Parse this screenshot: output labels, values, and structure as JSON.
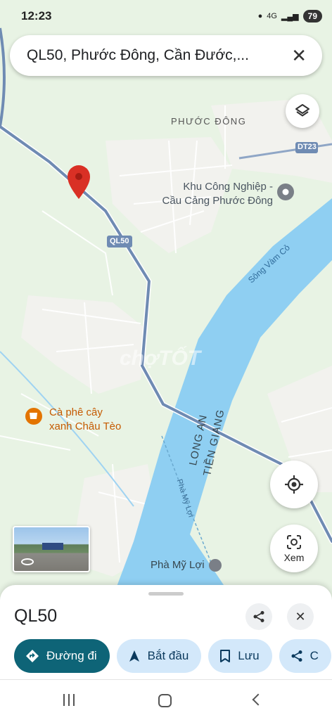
{
  "status": {
    "time": "12:23",
    "battery": "79",
    "network": "4G"
  },
  "search": {
    "query": "QL50, Phước Đông, Cần Đước,..."
  },
  "map": {
    "labels": {
      "area": "PHƯỚC ĐÔNG",
      "road_ql50": "QL50",
      "road_dt23": "DT23",
      "kcn_line1": "Khu Công Nghiệp -",
      "kcn_line2": "Cầu Cảng Phước Đông",
      "river": "Sông Vàm Cỏ",
      "province_a": "LONG AN",
      "province_b": "TIỀN GIANG",
      "cafe_line1": "Cà phê cây",
      "cafe_line2": "xanh Châu Tèo",
      "ferry_route": "Phà Mỹ Lợi",
      "ferry": "Phà Mỹ Lợi",
      "watermark": "chợTỐT"
    }
  },
  "controls": {
    "lens_label": "Xem"
  },
  "sheet": {
    "title": "QL50",
    "chips": [
      {
        "label": "Đường đi",
        "icon": "directions-icon"
      },
      {
        "label": "Bắt đầu",
        "icon": "navigation-arrow-icon"
      },
      {
        "label": "Lưu",
        "icon": "bookmark-icon"
      },
      {
        "label": "C",
        "icon": "share-icon"
      }
    ]
  },
  "colors": {
    "water": "#8fcff2",
    "land": "#e8f3e4",
    "road": "#6f8bb3",
    "pin": "#d93025",
    "primary_chip": "#0e6477",
    "chip": "#d3e8fa",
    "poi_cafe": "#e37400"
  }
}
